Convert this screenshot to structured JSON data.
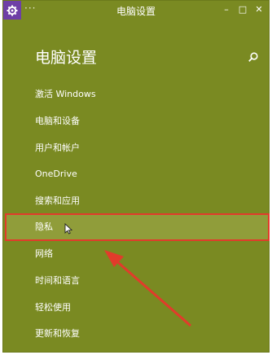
{
  "window": {
    "title": "电脑设置",
    "menu_glyph": "···",
    "buttons": {
      "minimize": "–",
      "maximize": "□",
      "close": "✕"
    }
  },
  "page": {
    "title": "电脑设置",
    "search_icon": "search-icon"
  },
  "nav": {
    "items": [
      {
        "label": "激活 Windows"
      },
      {
        "label": "电脑和设备"
      },
      {
        "label": "用户和帐户"
      },
      {
        "label": "OneDrive"
      },
      {
        "label": "搜索和应用"
      },
      {
        "label": "隐私"
      },
      {
        "label": "网络"
      },
      {
        "label": "时间和语言"
      },
      {
        "label": "轻松使用"
      },
      {
        "label": "更新和恢复"
      }
    ],
    "selected_index": 5
  },
  "colors": {
    "accent": "#7a8a22",
    "selected_bg": "#909d3a",
    "highlight_border": "#e23b2b",
    "app_icon_bg": "#6e3fa6"
  }
}
